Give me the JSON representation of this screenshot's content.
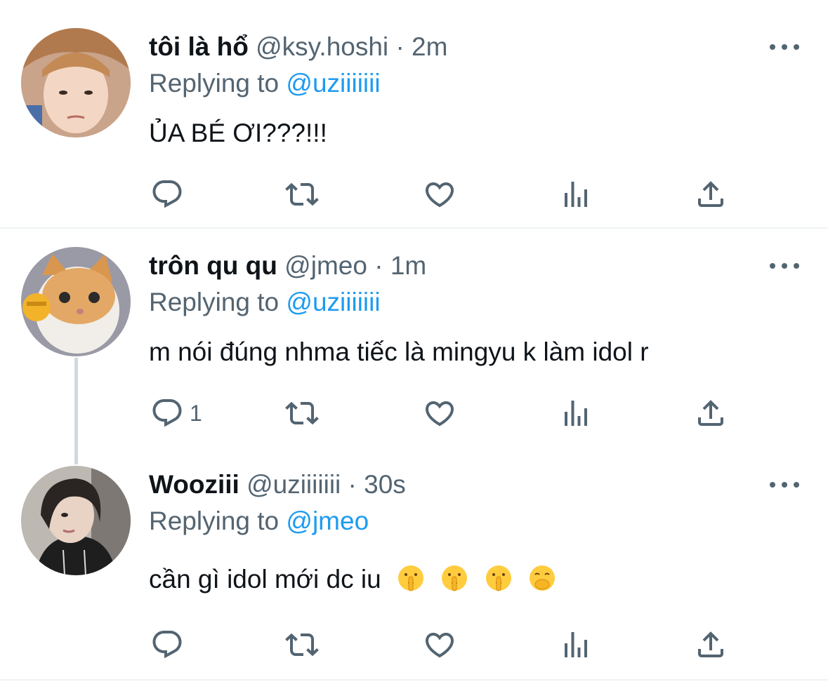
{
  "tweets": [
    {
      "name": "tôi là hổ",
      "handle": "@ksy.hoshi",
      "dot": "·",
      "time": "2m",
      "replying_prefix": "Replying to",
      "replying_to": "@uziiiiiii",
      "text": "ỦA BÉ ƠI???!!!",
      "reply_count": "",
      "avatar": "person-photo"
    },
    {
      "name": "trôn qu qu",
      "handle": "@jmeo",
      "dot": "·",
      "time": "1m",
      "replying_prefix": "Replying to",
      "replying_to": "@uziiiiiii",
      "text": "m nói đúng nhma tiếc là mingyu k làm idol r",
      "reply_count": "1",
      "avatar": "cat-photo"
    },
    {
      "name": "Wooziii",
      "handle": "@uziiiiiii",
      "dot": "·",
      "time": "30s",
      "replying_prefix": "Replying to",
      "replying_to": "@jmeo",
      "text": "cần gì idol mới dc iu",
      "emojis": [
        "shushing-face",
        "shushing-face",
        "shushing-face",
        "face-with-hand-over-mouth"
      ],
      "reply_count": "",
      "avatar": "person-photo"
    }
  ],
  "icons": {
    "reply": "reply-icon",
    "retweet": "retweet-icon",
    "like": "heart-icon",
    "analytics": "analytics-icon",
    "share": "share-icon",
    "more": "more-icon"
  },
  "colors": {
    "accent": "#1d9bf0",
    "secondary_text": "#536471",
    "divider": "#eff3f4"
  }
}
